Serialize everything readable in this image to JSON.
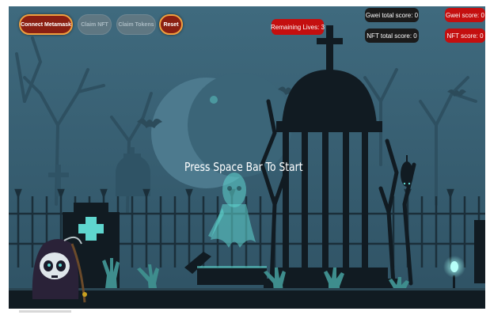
{
  "toolbar": {
    "connect_label": "Connect Metamask",
    "claim_nft_label": "Claim NFT",
    "claim_tokens_label": "Claim Tokens",
    "reset_label": "Reset"
  },
  "hud": {
    "lives": "Remaining Lives: 3",
    "gwei_total": "Gwei total score: 0",
    "nft_total": "NFT total score: 0",
    "gwei_score": "Gwei score: 0",
    "nft_score": "NFT score: 0"
  },
  "game": {
    "prompt": "Press Space Bar To Start"
  },
  "colors": {
    "sky": "#3a6174",
    "button_active": "#8a1f12",
    "button_border": "#f0a040",
    "pill_red": "#c40f0f",
    "silhouette": "#111b22",
    "ghost": "#5fd6cf"
  },
  "icons": {
    "tombstone": "cross-tombstone-icon",
    "gazebo": "graveyard-gazebo",
    "ghost": "ghost-figure",
    "player": "grim-reaper-character",
    "lantern": "glowing-lantern-icon"
  }
}
